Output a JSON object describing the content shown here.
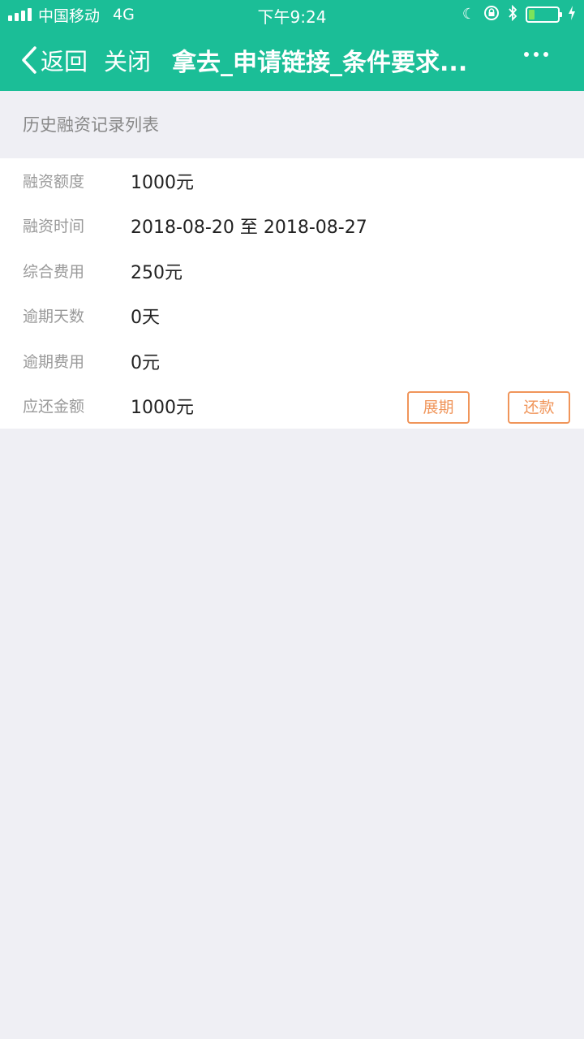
{
  "status_bar": {
    "carrier": "中国移动",
    "network": "4G",
    "time": "下午9:24",
    "battery_level": 0.2
  },
  "nav": {
    "back_label": "返回",
    "close_label": "关闭",
    "title": "拿去_申请链接_条件要求..."
  },
  "section": {
    "title": "历史融资记录列表"
  },
  "record": {
    "rows": [
      {
        "label": "融资额度",
        "value": "1000元"
      },
      {
        "label": "融资时间",
        "value": "2018-08-20 至 2018-08-27"
      },
      {
        "label": "综合费用",
        "value": "250元"
      },
      {
        "label": "逾期天数",
        "value": "0天"
      },
      {
        "label": "逾期费用",
        "value": "0元"
      },
      {
        "label": "应还金额",
        "value": "1000元"
      }
    ],
    "extend_label": "展期",
    "repay_label": "还款"
  },
  "colors": {
    "header": "#1bbe97",
    "accent": "#f0955a",
    "background": "#efeff4"
  }
}
